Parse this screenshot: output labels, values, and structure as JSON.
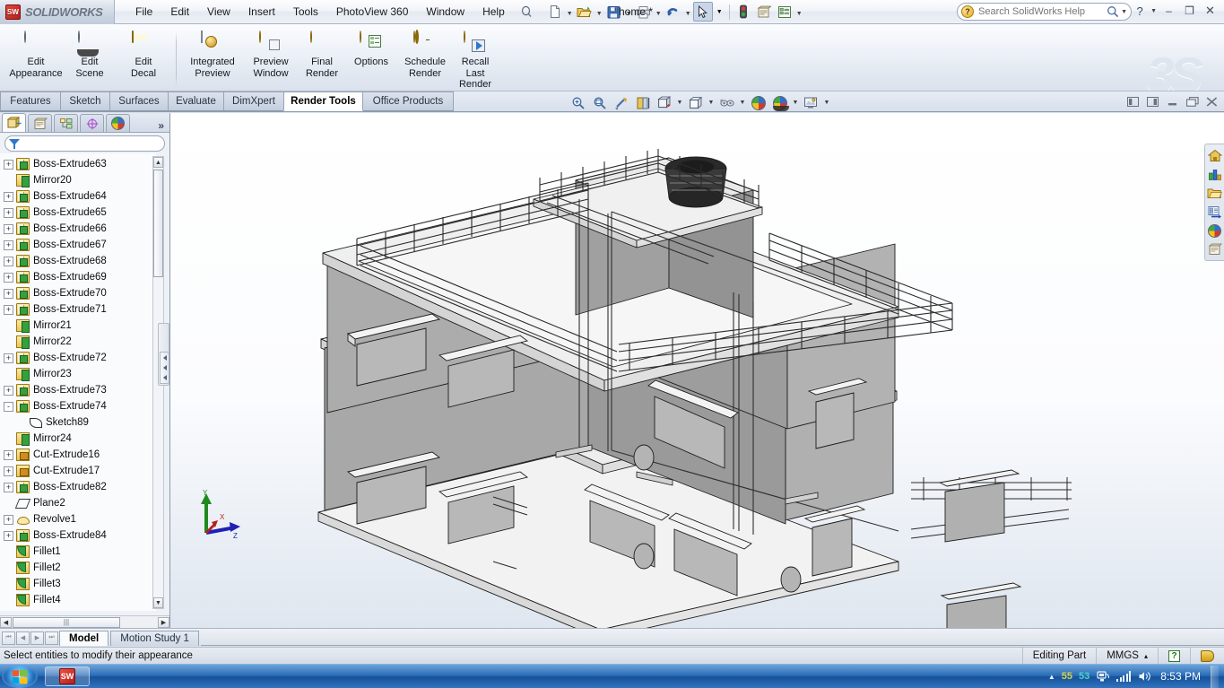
{
  "app": {
    "brand": "SOLIDWORKS",
    "brand_cube": "SW",
    "document_title": "home *",
    "watermark": "3S"
  },
  "menu": {
    "items": [
      "File",
      "Edit",
      "View",
      "Insert",
      "Tools",
      "PhotoView 360",
      "Window",
      "Help"
    ],
    "pin_icon": "pushpin-icon"
  },
  "quick_access": [
    {
      "name": "new-document-button",
      "icon": "new-document-icon",
      "caret": true
    },
    {
      "name": "open-document-button",
      "icon": "open-folder-icon",
      "caret": true
    },
    {
      "name": "save-button",
      "icon": "save-floppy-icon",
      "caret": true
    },
    {
      "name": "print-button",
      "icon": "printer-icon",
      "caret": true
    },
    {
      "name": "undo-button",
      "icon": "undo-arrow-icon",
      "caret": true
    },
    {
      "name": "select-button",
      "icon": "cursor-arrow-icon",
      "caret": true
    },
    {
      "name": "rebuild-button",
      "icon": "traffic-light-icon",
      "caret": false
    },
    {
      "name": "options-button",
      "icon": "options-gear-icon",
      "caret": false
    },
    {
      "name": "display-manager-button",
      "icon": "list-properties-icon",
      "caret": true
    }
  ],
  "search": {
    "placeholder": "Search SolidWorks Help",
    "value": "",
    "help_icon": "question-mark-icon",
    "magnifier_icon": "magnifier-icon"
  },
  "window_controls": {
    "minimize": "–",
    "maximize": "❐",
    "close": "✕"
  },
  "ribbon": {
    "groups": [
      {
        "items": [
          {
            "label": "Edit\nAppearance",
            "icon": "appearance-sphere-icon",
            "name": "edit-appearance-button"
          },
          {
            "label": "Edit\nScene",
            "icon": "scene-sphere-icon",
            "name": "edit-scene-button"
          },
          {
            "label": "Edit\nDecal",
            "icon": "decal-icon",
            "name": "edit-decal-button"
          }
        ]
      },
      {
        "items": [
          {
            "label": "Integrated\nPreview",
            "icon": "integrated-preview-icon",
            "name": "integrated-preview-button"
          },
          {
            "label": "Preview\nWindow",
            "icon": "preview-window-icon",
            "name": "preview-window-button"
          },
          {
            "label": "Final\nRender",
            "icon": "final-render-icon",
            "name": "final-render-button"
          },
          {
            "label": "Options",
            "icon": "render-options-icon",
            "name": "render-options-button"
          },
          {
            "label": "Schedule\nRender",
            "icon": "schedule-render-icon",
            "name": "schedule-render-button"
          },
          {
            "label": "Recall\nLast\nRender",
            "icon": "recall-last-render-icon",
            "name": "recall-last-render-button"
          }
        ]
      }
    ]
  },
  "command_tabs": [
    {
      "label": "Features",
      "active": false
    },
    {
      "label": "Sketch",
      "active": false
    },
    {
      "label": "Surfaces",
      "active": false
    },
    {
      "label": "Evaluate",
      "active": false
    },
    {
      "label": "DimXpert",
      "active": false
    },
    {
      "label": "Render Tools",
      "active": true
    },
    {
      "label": "Office Products",
      "active": false
    }
  ],
  "view_toolbar": [
    {
      "name": "zoom-to-fit-icon",
      "caret": false
    },
    {
      "name": "zoom-to-area-icon",
      "caret": false
    },
    {
      "name": "previous-view-icon",
      "caret": false
    },
    {
      "name": "section-view-icon",
      "caret": false
    },
    {
      "name": "view-orientation-icon",
      "caret": true
    },
    {
      "name": "display-style-icon",
      "caret": true
    },
    {
      "name": "hide-show-items-icon",
      "caret": true
    },
    {
      "name": "edit-appearance-icon",
      "caret": false
    },
    {
      "name": "apply-scene-icon",
      "caret": true
    },
    {
      "name": "view-settings-icon",
      "caret": true
    }
  ],
  "window_arrange": [
    {
      "name": "tile-left-icon"
    },
    {
      "name": "tile-right-icon"
    },
    {
      "name": "window-minimize-icon"
    },
    {
      "name": "window-restore-icon"
    },
    {
      "name": "window-close-icon"
    }
  ],
  "left_panel": {
    "tabs": [
      {
        "name": "feature-manager-tab",
        "icon": "feature-tree-icon",
        "active": true
      },
      {
        "name": "property-manager-tab",
        "icon": "property-manager-icon",
        "active": false
      },
      {
        "name": "configuration-manager-tab",
        "icon": "configuration-icon",
        "active": false
      },
      {
        "name": "dimxpert-manager-tab",
        "icon": "dimxpert-icon",
        "active": false
      },
      {
        "name": "display-manager-tab",
        "icon": "display-manager-sphere-icon",
        "active": false
      }
    ],
    "more_label": "»",
    "filter": {
      "placeholder": "",
      "value": "",
      "icon": "filter-funnel-icon"
    },
    "tree": [
      {
        "label": "Boss-Extrude63",
        "icon": "boss-extrude-icon",
        "expandable": true,
        "state": "+",
        "indent": 0
      },
      {
        "label": "Mirror20",
        "icon": "mirror-icon",
        "expandable": false,
        "state": "",
        "indent": 0
      },
      {
        "label": "Boss-Extrude64",
        "icon": "boss-extrude-icon",
        "expandable": true,
        "state": "+",
        "indent": 0
      },
      {
        "label": "Boss-Extrude65",
        "icon": "boss-extrude-icon",
        "expandable": true,
        "state": "+",
        "indent": 0
      },
      {
        "label": "Boss-Extrude66",
        "icon": "boss-extrude-icon",
        "expandable": true,
        "state": "+",
        "indent": 0
      },
      {
        "label": "Boss-Extrude67",
        "icon": "boss-extrude-icon",
        "expandable": true,
        "state": "+",
        "indent": 0
      },
      {
        "label": "Boss-Extrude68",
        "icon": "boss-extrude-icon",
        "expandable": true,
        "state": "+",
        "indent": 0
      },
      {
        "label": "Boss-Extrude69",
        "icon": "boss-extrude-icon",
        "expandable": true,
        "state": "+",
        "indent": 0
      },
      {
        "label": "Boss-Extrude70",
        "icon": "boss-extrude-icon",
        "expandable": true,
        "state": "+",
        "indent": 0
      },
      {
        "label": "Boss-Extrude71",
        "icon": "boss-extrude-icon",
        "expandable": true,
        "state": "+",
        "indent": 0
      },
      {
        "label": "Mirror21",
        "icon": "mirror-icon",
        "expandable": false,
        "state": "",
        "indent": 0
      },
      {
        "label": "Mirror22",
        "icon": "mirror-icon",
        "expandable": false,
        "state": "",
        "indent": 0
      },
      {
        "label": "Boss-Extrude72",
        "icon": "boss-extrude-icon",
        "expandable": true,
        "state": "+",
        "indent": 0
      },
      {
        "label": "Mirror23",
        "icon": "mirror-icon",
        "expandable": false,
        "state": "",
        "indent": 0
      },
      {
        "label": "Boss-Extrude73",
        "icon": "boss-extrude-icon",
        "expandable": true,
        "state": "+",
        "indent": 0
      },
      {
        "label": "Boss-Extrude74",
        "icon": "boss-extrude-icon",
        "expandable": true,
        "state": "-",
        "indent": 0
      },
      {
        "label": "Sketch89",
        "icon": "sketch-icon",
        "expandable": false,
        "state": "",
        "indent": 1
      },
      {
        "label": "Mirror24",
        "icon": "mirror-icon",
        "expandable": false,
        "state": "",
        "indent": 0
      },
      {
        "label": "Cut-Extrude16",
        "icon": "cut-extrude-icon",
        "expandable": true,
        "state": "+",
        "indent": 0
      },
      {
        "label": "Cut-Extrude17",
        "icon": "cut-extrude-icon",
        "expandable": true,
        "state": "+",
        "indent": 0
      },
      {
        "label": "Boss-Extrude82",
        "icon": "boss-extrude-icon",
        "expandable": true,
        "state": "+",
        "indent": 0
      },
      {
        "label": "Plane2",
        "icon": "plane-icon",
        "expandable": false,
        "state": "",
        "indent": 0
      },
      {
        "label": "Revolve1",
        "icon": "revolve-icon",
        "expandable": true,
        "state": "+",
        "indent": 0
      },
      {
        "label": "Boss-Extrude84",
        "icon": "boss-extrude-icon",
        "expandable": true,
        "state": "+",
        "indent": 0
      },
      {
        "label": "Fillet1",
        "icon": "fillet-icon",
        "expandable": false,
        "state": "",
        "indent": 0
      },
      {
        "label": "Fillet2",
        "icon": "fillet-icon",
        "expandable": false,
        "state": "",
        "indent": 0
      },
      {
        "label": "Fillet3",
        "icon": "fillet-icon",
        "expandable": false,
        "state": "",
        "indent": 0
      },
      {
        "label": "Fillet4",
        "icon": "fillet-icon",
        "expandable": false,
        "state": "",
        "indent": 0
      }
    ]
  },
  "viewport_sidebar": [
    {
      "name": "view-palette-home-icon"
    },
    {
      "name": "appearances-scenes-icon"
    },
    {
      "name": "design-library-icon"
    },
    {
      "name": "file-explorer-icon"
    },
    {
      "name": "search-sphere-icon"
    },
    {
      "name": "custom-properties-icon"
    }
  ],
  "triad": {
    "x_label": "X",
    "y_label": "Y",
    "z_label": "Z",
    "x_color": "#cc2222",
    "y_color": "#228b22",
    "z_color": "#2222cc"
  },
  "bottom_tabs": [
    {
      "label": "Model",
      "active": true
    },
    {
      "label": "Motion Study 1",
      "active": false
    }
  ],
  "nav_buttons": [
    "⏮",
    "◀",
    "▶",
    "⏭"
  ],
  "status_bar": {
    "message": "Select entities to modify their appearance",
    "editing_state": "Editing Part",
    "units": "MMGS",
    "units_caret": "▴",
    "help_badge": "?",
    "tag_icon": "tag-icon"
  },
  "taskbar": {
    "start_icon": "windows-start-orb-icon",
    "apps": [
      {
        "name": "solidworks-taskbar-button",
        "icon": "solidworks-cube-icon",
        "label": "SW"
      }
    ],
    "tray": {
      "expand_icon": "▲",
      "num1": "55",
      "num2": "53",
      "num1_color": "#d4d44a",
      "num2_color": "#4ad4c8",
      "network_icon": "network-icon",
      "signal_icon": "signal-bars-icon",
      "volume_icon": "volume-speaker-icon",
      "clock": "8:53 PM"
    }
  }
}
